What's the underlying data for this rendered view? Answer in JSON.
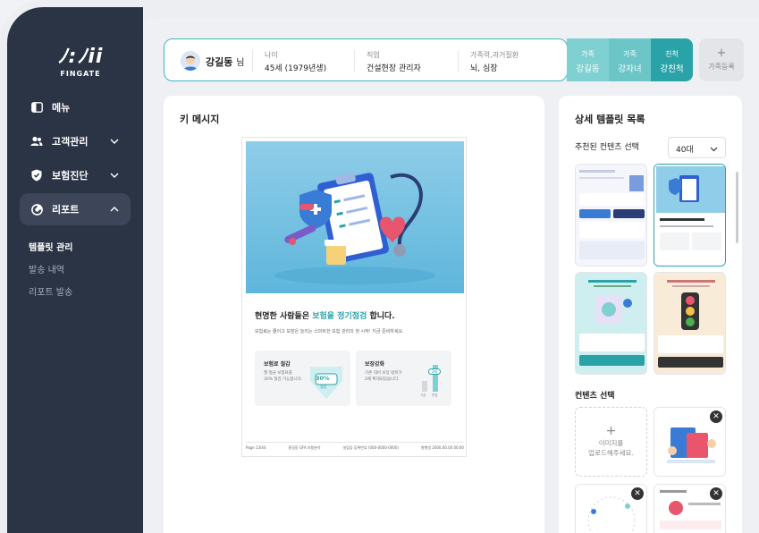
{
  "app": {
    "logo_text": "FINGATE"
  },
  "sidebar": {
    "items": [
      {
        "label": "메뉴",
        "icon": "menu-icon"
      },
      {
        "label": "고객관리",
        "icon": "users-icon"
      },
      {
        "label": "보험진단",
        "icon": "shield-check-icon"
      },
      {
        "label": "리포트",
        "icon": "report-icon",
        "active": true
      }
    ],
    "subitems": [
      {
        "label": "템플릿 관리",
        "active": true
      },
      {
        "label": "발송 내역"
      },
      {
        "label": "리포트 발송"
      }
    ]
  },
  "profile": {
    "name": "강길동",
    "honorific": "님",
    "age_label": "나이",
    "age_value": "45세 (1979년생)",
    "job_label": "직업",
    "job_value": "건설현장 관리자",
    "history_label": "가족력,과거질환",
    "history_value": "뇌, 심장"
  },
  "family": [
    {
      "relation": "가족",
      "name": "강길동",
      "color": "#7fd0d0"
    },
    {
      "relation": "가족",
      "name": "강자녀",
      "color": "#6cc6c8"
    },
    {
      "relation": "친척",
      "name": "강친척",
      "color": "#2aa3a8"
    }
  ],
  "family_add_label": "가족등록",
  "key_message": {
    "title": "키 메시지",
    "doc_headline_pre": "현명한 사람들은 ",
    "doc_headline_hl": "보험을 정기점검",
    "doc_headline_post": " 합니다.",
    "doc_sub": "보험료는 줄이고 보장은 늘리는 스마트한 보험 관리의 첫 시작! 지금 준비하세요.",
    "card1_title": "보험료 절감",
    "card1_desc_1": "월 평균 보험료를",
    "card1_desc_2": "30% 절감 가능합니다.",
    "card1_badge": "30%",
    "card1_badge_sub": "절감",
    "card2_title": "보장강화",
    "card2_desc_1": "기존 대비 보장 범위가",
    "card2_desc_2": "2배 확대되었습니다.",
    "card2_badge": "2배",
    "card2_bar_label_1": "기존",
    "card2_bar_label_2": "변경",
    "footer_page": "Page 13/44",
    "footer_company": "홍길동 GFA 보험분석",
    "footer_contact": "설립등 등록번호 (000-0000-0000)",
    "footer_date": "발행일 2000.00.00 00:00"
  },
  "template_list": {
    "title": "상세 템플릿 목록",
    "recommend_label": "추천된 컨텐츠 선택",
    "age_select": "40대",
    "content_label": "컨텐츠 선택",
    "upload_text_1": "이미지를",
    "upload_text_2": "업로드해주세요."
  },
  "colors": {
    "accent": "#2aa3a8",
    "sidebar": "#2b3445"
  }
}
